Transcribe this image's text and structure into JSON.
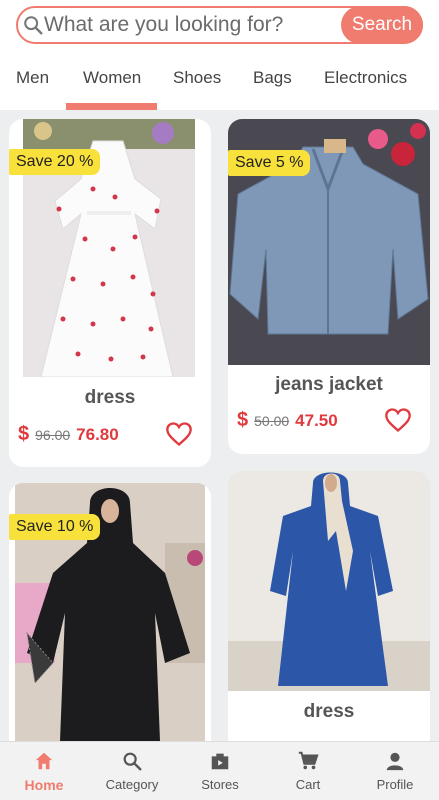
{
  "search": {
    "placeholder": "What are you looking for?",
    "button_label": "Search"
  },
  "tabs": [
    {
      "label": "Men"
    },
    {
      "label": "Women",
      "active": true
    },
    {
      "label": "Shoes"
    },
    {
      "label": "Bags"
    },
    {
      "label": "Electronics"
    }
  ],
  "colors": {
    "accent": "#f07b6f",
    "price": "#e0393e",
    "badge": "#f8e13a"
  },
  "products": [
    {
      "badge": "Save 20 %",
      "title": "dress",
      "currency": "$",
      "old_price": "96.00",
      "price": "76.80",
      "image": "white dress with red cherry print"
    },
    {
      "badge": "Save 5 %",
      "title": "jeans jacket",
      "currency": "$",
      "old_price": "50.00",
      "price": "47.50",
      "image": "denim jacket"
    },
    {
      "badge": "Save 10 %",
      "title": "",
      "image": "black abaya with lace sleeves"
    },
    {
      "badge": "",
      "title": "dress",
      "image": "blue long dress"
    }
  ],
  "bottom_nav": [
    {
      "label": "Home",
      "icon": "home-icon",
      "active": true
    },
    {
      "label": "Category",
      "icon": "search-icon"
    },
    {
      "label": "Stores",
      "icon": "store-icon"
    },
    {
      "label": "Cart",
      "icon": "cart-icon"
    },
    {
      "label": "Profile",
      "icon": "profile-icon"
    }
  ]
}
